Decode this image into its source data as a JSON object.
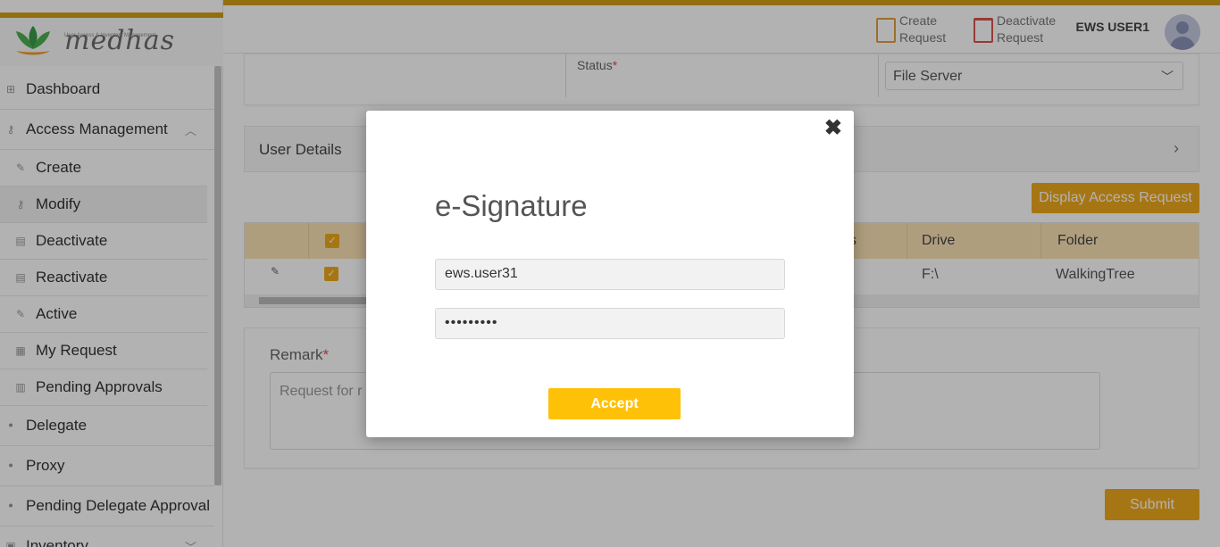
{
  "app": {
    "logo_text": "medhas",
    "logo_subtitle": "User Access & Inventory Management"
  },
  "sidebar": {
    "items": [
      {
        "label": "Dashboard",
        "icon": "grid-icon"
      },
      {
        "label": "Access Management",
        "icon": "key-icon"
      },
      {
        "label": "Create",
        "icon": "edit-icon"
      },
      {
        "label": "Modify",
        "icon": "key-icon"
      },
      {
        "label": "Deactivate",
        "icon": "document-icon"
      },
      {
        "label": "Reactivate",
        "icon": "document-icon"
      },
      {
        "label": "Active",
        "icon": "edit-icon"
      },
      {
        "label": "My Request",
        "icon": "table-icon"
      },
      {
        "label": "Pending Approvals",
        "icon": "clipboard-icon"
      },
      {
        "label": "Delegate",
        "icon": "people-icon"
      },
      {
        "label": "Proxy",
        "icon": "people-icon"
      },
      {
        "label": "Pending Delegate Approval",
        "icon": "people-icon"
      },
      {
        "label": "Inventory",
        "icon": "box-icon"
      }
    ]
  },
  "header": {
    "create_request": "Create\nRequest",
    "create_line1": "Create",
    "create_line2": "Request",
    "deactivate_line1": "Deactivate",
    "deactivate_line2": "Request",
    "username": "EWS USER1"
  },
  "form": {
    "status_label": "Status",
    "required_mark": "*",
    "server_select": "File Server",
    "user_details_label": "User Details",
    "display_button": "Display Access Request"
  },
  "table": {
    "columns": [
      "",
      "",
      "",
      "Drive",
      "Folder"
    ],
    "header_partial": "s",
    "row": {
      "drive": "F:\\",
      "folder": "WalkingTree"
    }
  },
  "remark": {
    "label": "Remark",
    "placeholder_visible": "Request for r"
  },
  "submit_label": "Submit",
  "modal": {
    "title": "e-Signature",
    "username_value": "ews.user31",
    "password_value": "•••••••••",
    "accept_label": "Accept",
    "close_symbol": "✖"
  },
  "colors": {
    "accent": "#f0a91e",
    "accept": "#ffc107",
    "topbar": "#d4a017",
    "required": "#d9534f"
  }
}
